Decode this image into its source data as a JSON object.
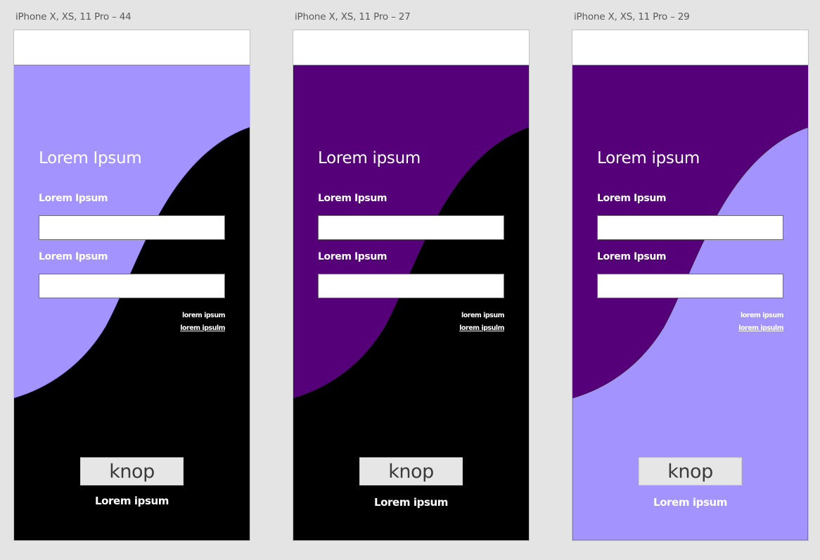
{
  "artboards": [
    {
      "label": "iPhone X, XS, 11 Pro – 44",
      "top_color": "#a393ff",
      "bottom_color": "#000000",
      "title": "Lorem Ipsum",
      "field1_label": "Lorem Ipsum",
      "field1_value": "",
      "field2_label": "Lorem Ipsum",
      "field2_value": "",
      "small_text": "lorem ipsum",
      "small_link": "lorem ipsulm",
      "button_label": "knop",
      "bottom_text": "Lorem ipsum"
    },
    {
      "label": "iPhone X, XS, 11 Pro – 27",
      "top_color": "#550078",
      "bottom_color": "#000000",
      "title": "Lorem ipsum",
      "field1_label": "Lorem Ipsum",
      "field1_value": "",
      "field2_label": "Lorem Ipsum",
      "field2_value": "",
      "small_text": "lorem ipsum",
      "small_link": "lorem ipsulm",
      "button_label": "knop",
      "bottom_text": "Lorem ipsum"
    },
    {
      "label": "iPhone X, XS, 11 Pro – 29",
      "top_color": "#550078",
      "bottom_color": "#a393ff",
      "title": "Lorem ipsum",
      "field1_label": "Lorem Ipsum",
      "field1_value": "",
      "field2_label": "Lorem Ipsum",
      "field2_value": "",
      "small_text": "lorem ipsum",
      "small_link": "lorem ipsulm",
      "button_label": "knop",
      "bottom_text": "Lorem ipsum"
    }
  ]
}
